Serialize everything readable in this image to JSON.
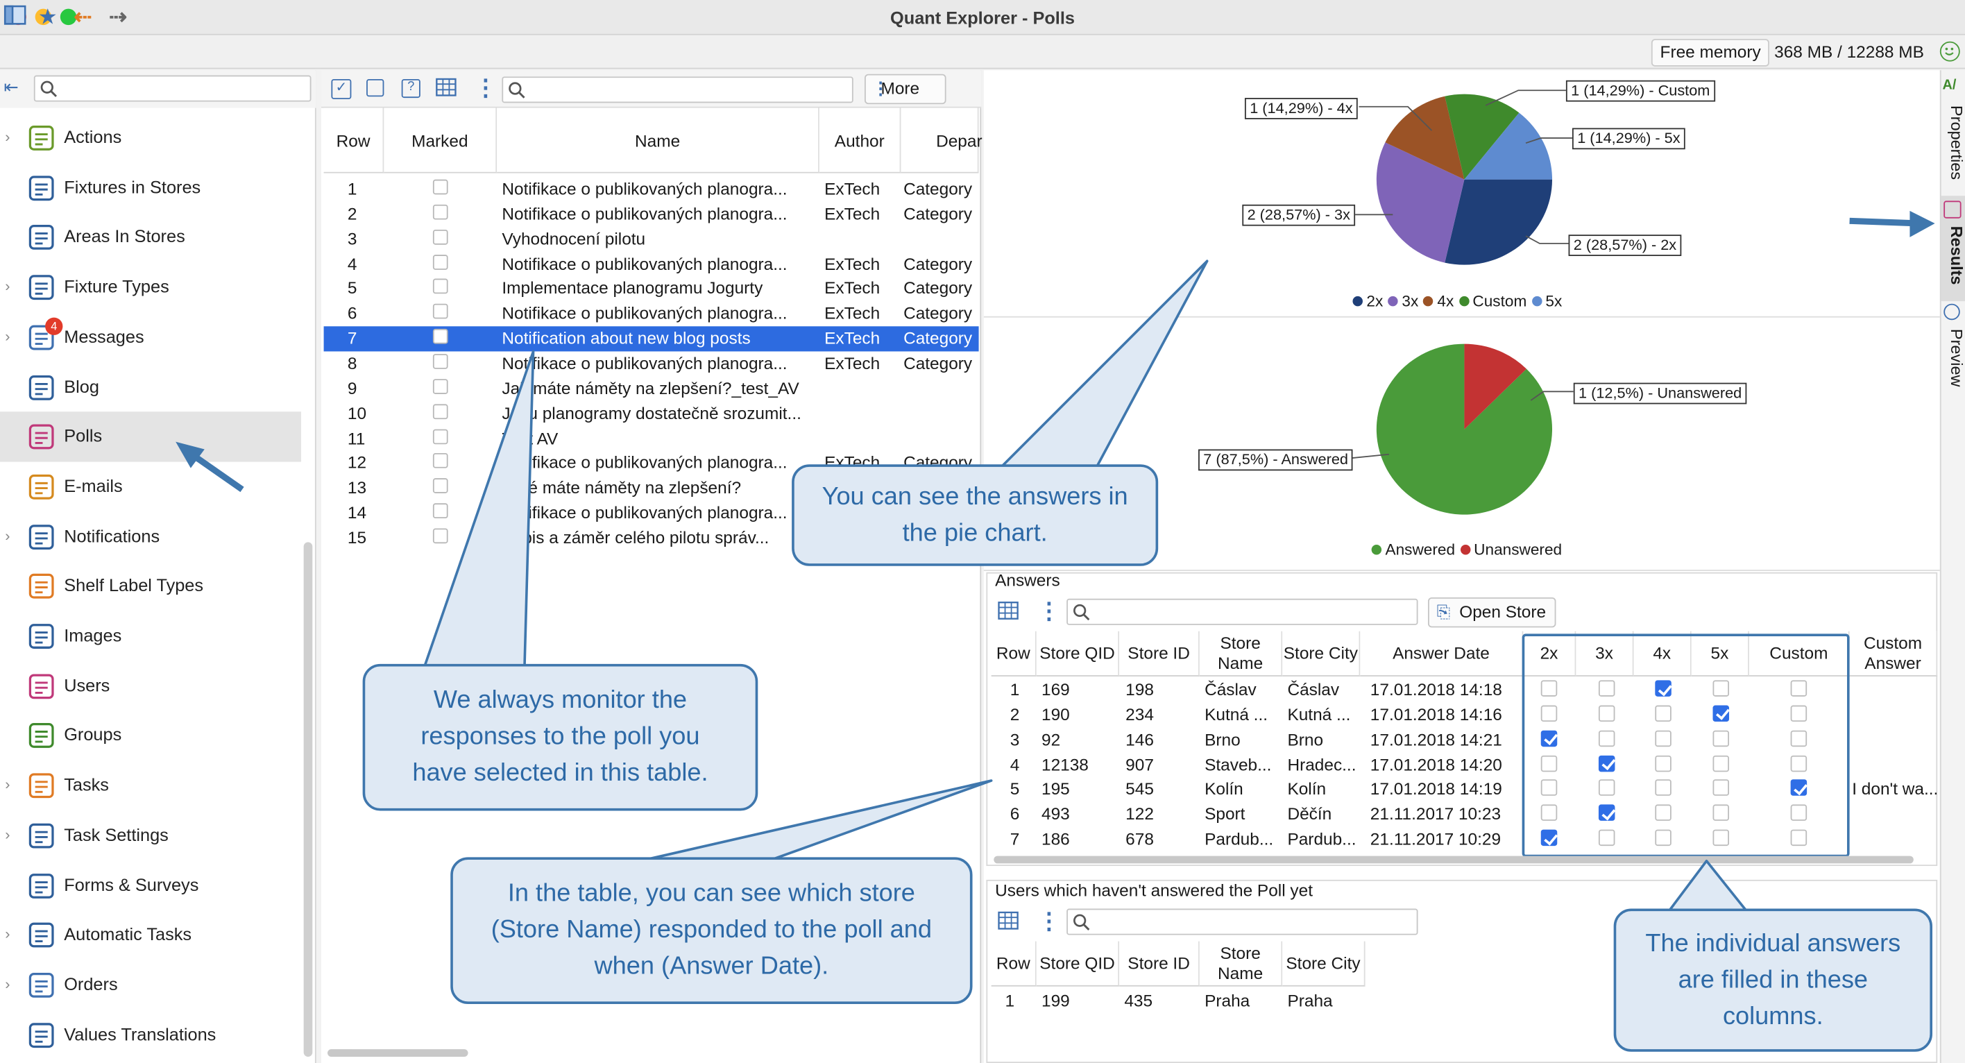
{
  "window": {
    "title": "Quant Explorer - Polls"
  },
  "toolbar": {
    "memory_label": "Free memory",
    "memory_value": "368 MB / 12288 MB"
  },
  "sidebar": {
    "items": [
      {
        "label": "Actions",
        "icon": "actions-icon",
        "chevron": true
      },
      {
        "label": "Fixtures in Stores",
        "icon": "fixtures-icon",
        "chevron": false
      },
      {
        "label": "Areas In Stores",
        "icon": "areas-icon",
        "chevron": false
      },
      {
        "label": "Fixture Types",
        "icon": "fixture-types-icon",
        "chevron": true
      },
      {
        "label": "Messages",
        "icon": "messages-icon",
        "chevron": true,
        "badge": "4"
      },
      {
        "label": "Blog",
        "icon": "blog-icon",
        "chevron": false
      },
      {
        "label": "Polls",
        "icon": "polls-icon",
        "chevron": false,
        "selected": true
      },
      {
        "label": "E-mails",
        "icon": "email-icon",
        "chevron": false
      },
      {
        "label": "Notifications",
        "icon": "bell-icon",
        "chevron": true
      },
      {
        "label": "Shelf Label Types",
        "icon": "price-tag-icon",
        "chevron": false
      },
      {
        "label": "Images",
        "icon": "image-icon",
        "chevron": false
      },
      {
        "label": "Users",
        "icon": "user-icon",
        "chevron": false
      },
      {
        "label": "Groups",
        "icon": "group-icon",
        "chevron": false
      },
      {
        "label": "Tasks",
        "icon": "task-check-icon",
        "chevron": true
      },
      {
        "label": "Task Settings",
        "icon": "task-settings-icon",
        "chevron": true
      },
      {
        "label": "Forms & Surveys",
        "icon": "form-icon",
        "chevron": false
      },
      {
        "label": "Automatic Tasks",
        "icon": "clock-task-icon",
        "chevron": true
      },
      {
        "label": "Orders",
        "icon": "orders-icon",
        "chevron": true
      },
      {
        "label": "Values Translations",
        "icon": "translate-icon",
        "chevron": false
      }
    ]
  },
  "polls": {
    "more_label": "More",
    "columns": [
      "Row",
      "Marked",
      "Name",
      "Author",
      "Depar"
    ],
    "rows": [
      {
        "row": "1",
        "name": "Notifikace o publikovaných planogra...",
        "author": "ExTech",
        "dept": "Category"
      },
      {
        "row": "2",
        "name": "Notifikace o publikovaných planogra...",
        "author": "ExTech",
        "dept": "Category"
      },
      {
        "row": "3",
        "name": "Vyhodnocení pilotu",
        "author": "",
        "dept": ""
      },
      {
        "row": "4",
        "name": "Notifikace o publikovaných planogra...",
        "author": "ExTech",
        "dept": "Category"
      },
      {
        "row": "5",
        "name": "Implementace planogramu Jogurty",
        "author": "ExTech",
        "dept": "Category"
      },
      {
        "row": "6",
        "name": "Notifikace o publikovaných planogra...",
        "author": "ExTech",
        "dept": "Category"
      },
      {
        "row": "7",
        "name": "Notification about new blog posts",
        "author": "ExTech",
        "dept": "Category",
        "selected": true
      },
      {
        "row": "8",
        "name": "Notifikace o publikovaných planogra...",
        "author": "ExTech",
        "dept": "Category"
      },
      {
        "row": "9",
        "name": "Jak máte náměty na zlepšení?_test_AV",
        "author": "",
        "dept": ""
      },
      {
        "row": "10",
        "name": "Jsou planogramy dostatečně srozumit...",
        "author": "",
        "dept": ""
      },
      {
        "row": "11",
        "name": "Test AV",
        "author": "",
        "dept": ""
      },
      {
        "row": "12",
        "name": "Notifikace o publikovaných planogra...",
        "author": "ExTech",
        "dept": "Category"
      },
      {
        "row": "13",
        "name": "Jaké máte náměty na zlepšení?",
        "author": "",
        "dept": ""
      },
      {
        "row": "14",
        "name": "Notifikace o publikovaných planogra...",
        "author": "",
        "dept": ""
      },
      {
        "row": "15",
        "name": "Popis a záměr celého pilotu správ...",
        "author": "",
        "dept": ""
      }
    ]
  },
  "chart_data": [
    {
      "type": "pie",
      "labels": [
        "2x",
        "3x",
        "4x",
        "Custom",
        "5x"
      ],
      "values": [
        2,
        2,
        1,
        1,
        1
      ],
      "data_labels": [
        "2 (28,57%) - 2x",
        "2 (28,57%) - 3x",
        "1 (14,29%) - 4x",
        "1 (14,29%) - Custom",
        "1 (14,29%) - 5x"
      ],
      "colors": [
        "#1f3f78",
        "#7f64b8",
        "#9b5326",
        "#3f8a2c",
        "#5e8bd0"
      ],
      "legend": "bottom"
    },
    {
      "type": "pie",
      "labels": [
        "Answered",
        "Unanswered"
      ],
      "values": [
        7,
        1
      ],
      "data_labels": [
        "7 (87,5%) - Answered",
        "1 (12,5%) - Unanswered"
      ],
      "colors": [
        "#4a9b3a",
        "#c33333"
      ],
      "legend": "bottom"
    }
  ],
  "answers": {
    "title": "Answers",
    "open_store_label": "Open Store",
    "columns": [
      "Row",
      "Store QID",
      "Store ID",
      "Store Name",
      "Store City",
      "Answer Date",
      "2x",
      "3x",
      "4x",
      "5x",
      "Custom",
      "Custom Answer"
    ],
    "rows": [
      {
        "row": "1",
        "qid": "169",
        "sid": "198",
        "name": "Čáslav",
        "city": "Čáslav",
        "date": "17.01.2018 14:18",
        "checks": [
          false,
          false,
          true,
          false,
          false
        ],
        "custom": ""
      },
      {
        "row": "2",
        "qid": "190",
        "sid": "234",
        "name": "Kutná ...",
        "city": "Kutná ...",
        "date": "17.01.2018 14:16",
        "checks": [
          false,
          false,
          false,
          true,
          false
        ],
        "custom": ""
      },
      {
        "row": "3",
        "qid": "92",
        "sid": "146",
        "name": "Brno",
        "city": "Brno",
        "date": "17.01.2018 14:21",
        "checks": [
          true,
          false,
          false,
          false,
          false
        ],
        "custom": ""
      },
      {
        "row": "4",
        "qid": "12138",
        "sid": "907",
        "name": "Staveb...",
        "city": "Hradec...",
        "date": "17.01.2018 14:20",
        "checks": [
          false,
          true,
          false,
          false,
          false
        ],
        "custom": ""
      },
      {
        "row": "5",
        "qid": "195",
        "sid": "545",
        "name": "Kolín",
        "city": "Kolín",
        "date": "17.01.2018 14:19",
        "checks": [
          false,
          false,
          false,
          false,
          true
        ],
        "custom": "I don't wa..."
      },
      {
        "row": "6",
        "qid": "493",
        "sid": "122",
        "name": "Sport",
        "city": "Děčín",
        "date": "21.11.2017 10:23",
        "checks": [
          false,
          true,
          false,
          false,
          false
        ],
        "custom": ""
      },
      {
        "row": "7",
        "qid": "186",
        "sid": "678",
        "name": "Pardub...",
        "city": "Pardub...",
        "date": "21.11.2017 10:29",
        "checks": [
          true,
          false,
          false,
          false,
          false
        ],
        "custom": ""
      }
    ]
  },
  "unanswered": {
    "title": "Users which haven't answered the Poll yet",
    "columns": [
      "Row",
      "Store QID",
      "Store ID",
      "Store Name",
      "Store City"
    ],
    "rows": [
      {
        "row": "1",
        "qid": "199",
        "sid": "435",
        "name": "Praha",
        "city": "Praha"
      }
    ]
  },
  "right_tabs": [
    "Properties",
    "Results",
    "Preview"
  ],
  "callouts": {
    "pie": "You can see the answers in the pie chart.",
    "monitor": "We always monitor the responses to the poll you have selected in this table.",
    "table": "In the table, you can see which store (Store Name) responded to the poll and when (Answer Date).",
    "columns": "The individual answers are filled in these columns."
  }
}
